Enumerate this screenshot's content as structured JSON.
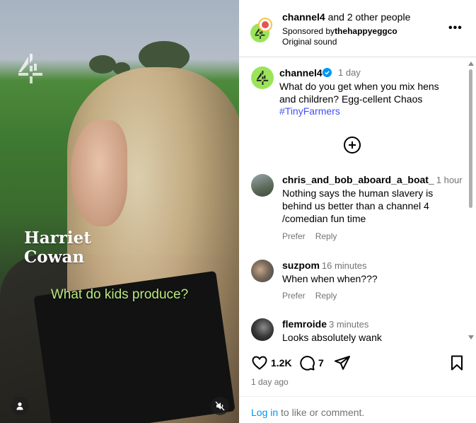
{
  "video": {
    "name_line1": "Harriet",
    "name_line2": "Cowan",
    "subtitle": "What do kids produce?",
    "watermark_icon": "channel4-logo-icon",
    "user_icon": "user-icon",
    "mute_icon": "muted-speaker-icon"
  },
  "header": {
    "user": "channel4",
    "others": "and 2 other people",
    "sponsored_prefix": "Sponsored by",
    "sponsor": "thehappyeggco",
    "audio": "Original sound",
    "more": "•••"
  },
  "caption": {
    "user": "channel4",
    "time": "1 day",
    "text": "What do you get when you mix hens and children? Egg-cellent Chaos",
    "hashtag": "#TinyFarmers"
  },
  "comments": [
    {
      "user": "chris_and_bob_aboard_a_boat_",
      "time": "1 hour",
      "text": "Nothing says the human slavery is behind us better than a channel 4 /comedian fun time",
      "like": "Prefer",
      "reply": "Reply"
    },
    {
      "user": "suzpom",
      "time": "16 minutes",
      "text": "When when when???",
      "like": "Prefer",
      "reply": "Reply"
    },
    {
      "user": "flemroide",
      "time": "3 minutes",
      "text": "Looks absolutely wank"
    }
  ],
  "actions": {
    "likes": "1.2K",
    "comments": "7"
  },
  "post_time": "1 day ago",
  "login": {
    "link": "Log in",
    "rest": " to like or comment."
  },
  "colors": {
    "channel4_green": "#9be45a",
    "link_blue": "#0095f6",
    "hashtag_blue": "#4150f7",
    "subtitle_green": "#b7e87e"
  }
}
